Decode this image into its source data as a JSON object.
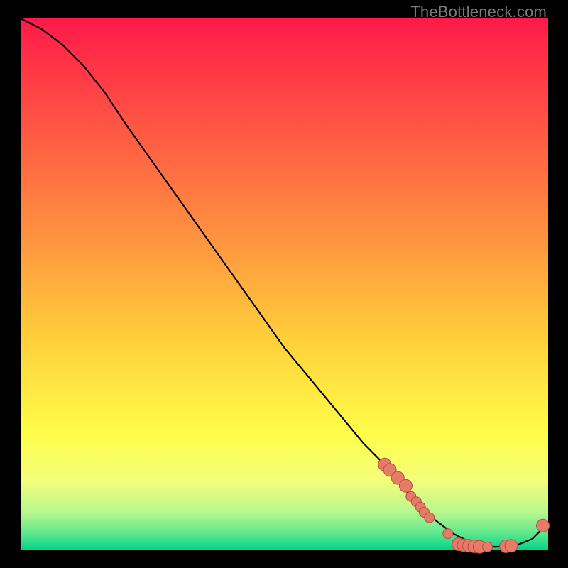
{
  "watermark": "TheBottleneck.com",
  "chart_data": {
    "type": "line",
    "title": "",
    "xlabel": "",
    "ylabel": "",
    "xlim": [
      0,
      100
    ],
    "ylim": [
      0,
      100
    ],
    "gradient_stops": [
      {
        "pct": 0,
        "color": "#ff1a48"
      },
      {
        "pct": 20,
        "color": "#ff5544"
      },
      {
        "pct": 40,
        "color": "#ff8f40"
      },
      {
        "pct": 60,
        "color": "#ffce3b"
      },
      {
        "pct": 78,
        "color": "#fffd48"
      },
      {
        "pct": 87,
        "color": "#f3fe7a"
      },
      {
        "pct": 93,
        "color": "#b8f78f"
      },
      {
        "pct": 97,
        "color": "#5de78d"
      },
      {
        "pct": 100,
        "color": "#00d68a"
      }
    ],
    "series": [
      {
        "name": "curve",
        "x": [
          0,
          4,
          8,
          12,
          16,
          20,
          25,
          30,
          35,
          40,
          45,
          50,
          55,
          60,
          65,
          70,
          74,
          78,
          82,
          86,
          90,
          94,
          97,
          100
        ],
        "y": [
          100,
          98,
          95,
          91,
          86,
          80,
          73,
          66,
          59,
          52,
          45,
          38,
          32,
          26,
          20,
          15,
          10,
          6,
          3,
          1,
          0.5,
          0.8,
          2,
          5
        ]
      }
    ],
    "markers": [
      {
        "x": 69,
        "y": 16,
        "size": "big"
      },
      {
        "x": 70,
        "y": 15,
        "size": "big"
      },
      {
        "x": 71.5,
        "y": 13.5,
        "size": "big"
      },
      {
        "x": 73,
        "y": 12,
        "size": "big"
      },
      {
        "x": 74,
        "y": 10,
        "size": "sm"
      },
      {
        "x": 75,
        "y": 9,
        "size": "sm"
      },
      {
        "x": 75.8,
        "y": 8,
        "size": "sm"
      },
      {
        "x": 76.5,
        "y": 7,
        "size": "sm"
      },
      {
        "x": 77.5,
        "y": 6,
        "size": "sm"
      },
      {
        "x": 81,
        "y": 3,
        "size": "sm"
      },
      {
        "x": 83,
        "y": 1,
        "size": "big"
      },
      {
        "x": 84,
        "y": 0.8,
        "size": "big"
      },
      {
        "x": 85,
        "y": 0.7,
        "size": "big"
      },
      {
        "x": 86,
        "y": 0.6,
        "size": "big"
      },
      {
        "x": 87,
        "y": 0.5,
        "size": "big"
      },
      {
        "x": 88.5,
        "y": 0.5,
        "size": "sm"
      },
      {
        "x": 92,
        "y": 0.6,
        "size": "big"
      },
      {
        "x": 93,
        "y": 0.7,
        "size": "big"
      },
      {
        "x": 99,
        "y": 4.5,
        "size": "big"
      }
    ]
  }
}
